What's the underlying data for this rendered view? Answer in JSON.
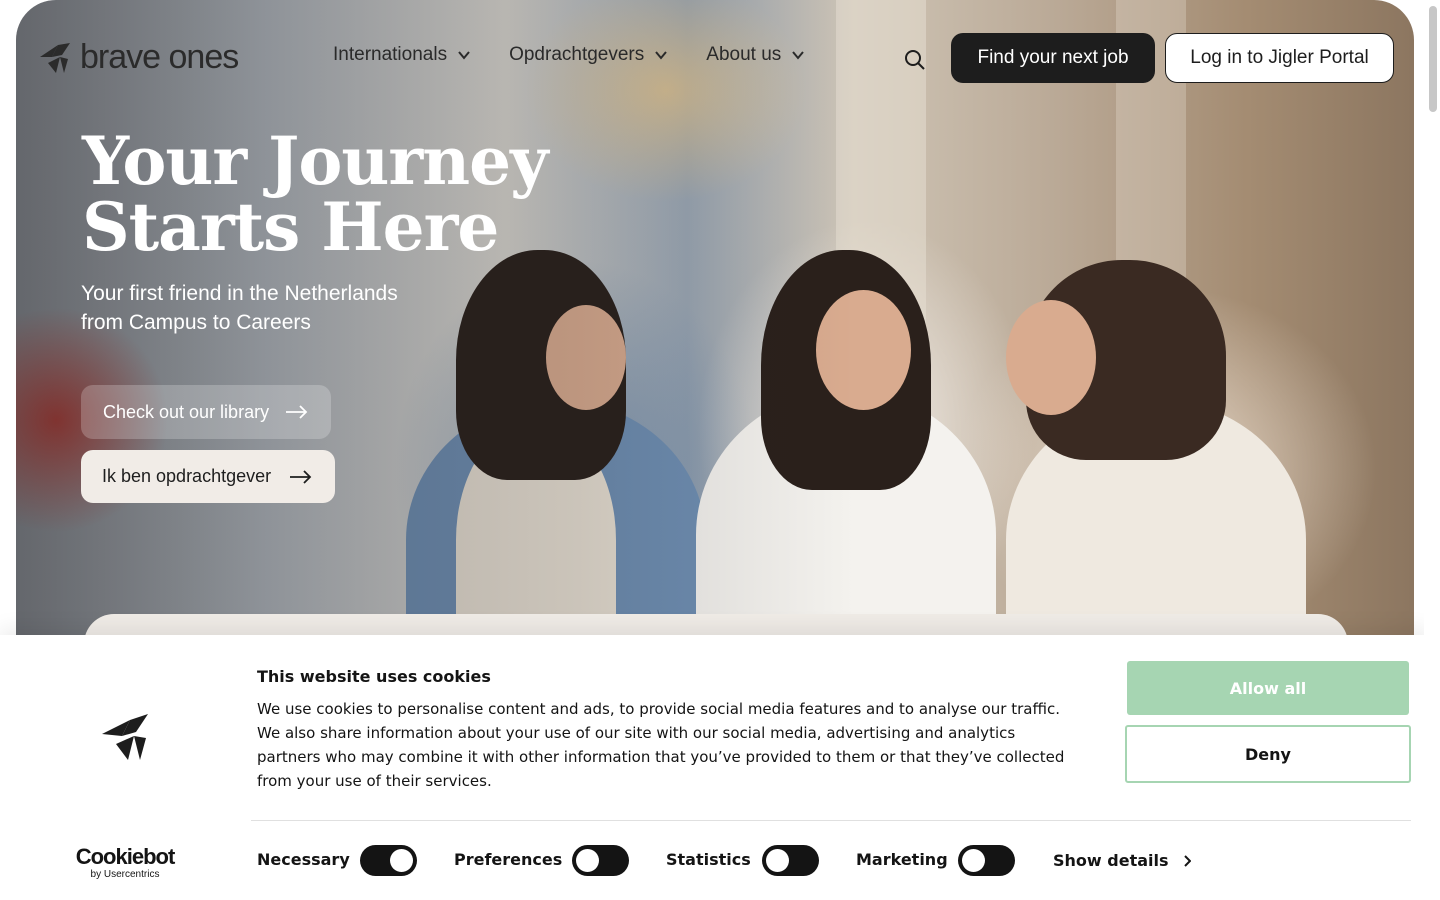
{
  "header": {
    "logo_text": "brave ones",
    "nav": [
      {
        "label": "Internationals"
      },
      {
        "label": "Opdrachtgevers"
      },
      {
        "label": "About us"
      }
    ],
    "find_job_label": "Find your next job",
    "login_label": "Log in to Jigler Portal"
  },
  "hero": {
    "title_line1": "Your Journey",
    "title_line2": "Starts Here",
    "subtitle_line1": "Your first friend in the Netherlands",
    "subtitle_line2": "from Campus to Careers",
    "library_button": "Check out our library",
    "opdrachtgever_button": "Ik ben opdrachtgever"
  },
  "cookie_banner": {
    "title": "This website uses cookies",
    "text": "We use cookies to personalise content and ads, to provide social media features and to analyse our traffic. We also share information about your use of our site with our social media, advertising and analytics partners who may combine it with other information that you’ve provided to them or that they’ve collected from your use of their services.",
    "allow_all": "Allow all",
    "deny": "Deny",
    "provider_name": "Cookiebot",
    "provider_sub": "by Usercentrics",
    "toggles": [
      {
        "label": "Necessary",
        "on": true
      },
      {
        "label": "Preferences",
        "on": false
      },
      {
        "label": "Statistics",
        "on": false
      },
      {
        "label": "Marketing",
        "on": false
      }
    ],
    "show_details": "Show details"
  },
  "colors": {
    "accent_green": "#a6d5b2",
    "dark": "#1d1d1d",
    "cream": "#f1ece7"
  }
}
